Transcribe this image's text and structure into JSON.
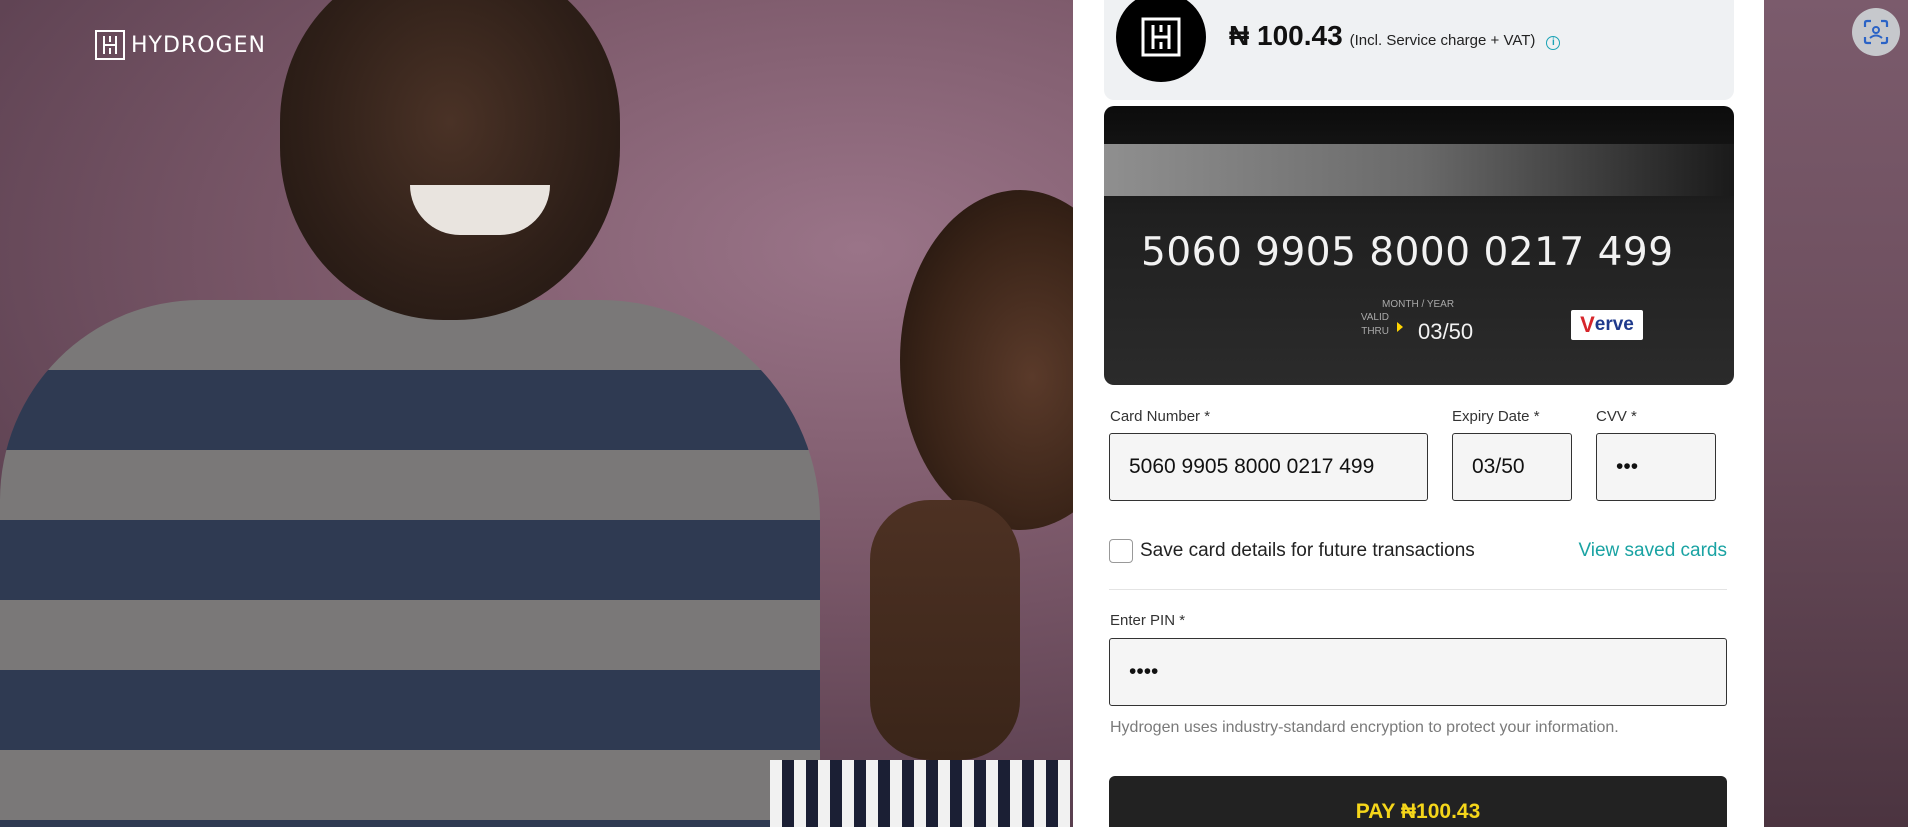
{
  "brand": {
    "logo_text": "HYDROGEN"
  },
  "payment": {
    "amount": "₦ 100.43",
    "amount_note": "(Incl. Service charge + VAT)"
  },
  "card_preview": {
    "number": "5060  9905 8000 0217 499",
    "valid_thru_line1": "VALID",
    "valid_thru_line2": "THRU",
    "month_year_label": "MONTH / YEAR",
    "expiry": "03/50",
    "scheme_rest": "erve",
    "scheme_initial": "V"
  },
  "form": {
    "card_number_label": "Card Number *",
    "card_number_value": "5060 9905 8000 0217 499",
    "expiry_label": "Expiry Date *",
    "expiry_value": "03/50",
    "cvv_label": "CVV *",
    "cvv_value": "•••",
    "save_card_label": "Save card details for future transactions",
    "save_card_checked": false,
    "view_saved_cards": "View saved cards",
    "pin_label": "Enter PIN *",
    "pin_value": "••••",
    "encryption_note": "Hydrogen uses industry-standard encryption to protect your information.",
    "pay_button": "PAY ₦100.43"
  },
  "colors": {
    "accent_teal": "#1aa3a3",
    "pay_text": "#f5d61a",
    "pay_bg": "#222222"
  }
}
